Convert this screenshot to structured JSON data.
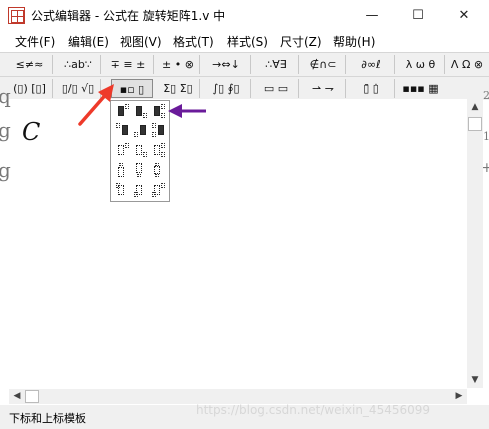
{
  "window": {
    "title": "公式编辑器 - 公式在 旋转矩阵1.v 中",
    "minimize_glyph": "—",
    "maximize_glyph": "☐",
    "close_glyph": "✕"
  },
  "menu": [
    "文件(F)",
    "编辑(E)",
    "视图(V)",
    "格式(T)",
    "样式(S)",
    "尺寸(Z)",
    "帮助(H)"
  ],
  "toolbar_row1": [
    "≤≠≈",
    "∴ab∵",
    "∓ ≡ ±",
    "± • ⊗",
    "→⇔↓",
    "∴∀∃",
    "∉∩⊂",
    "∂∞ℓ",
    "λ ω θ",
    "Λ Ω ⊗"
  ],
  "toolbar_row2": [
    "(▯) [▯]",
    "▯/▯ √▯",
    "▪▫ ▯",
    "Σ▯ Σ▯",
    "∫▯ ∮▯",
    "▭ ▭",
    "⇀ ⇁",
    "▯̄ ▯̇",
    "▪▪▪ ▦"
  ],
  "editor": {
    "math_char": "C",
    "faint_chars": [
      "q",
      "g",
      "g"
    ],
    "right_chars": [
      "2",
      "1",
      "+"
    ]
  },
  "popup_title": "下标和上标模板",
  "status": {
    "text": "下标和上标模板",
    "watermark": "https://blog.csdn.net/weixin_45456099"
  },
  "colors": {
    "red_arrow": "#ee3a2a",
    "purple_arrow": "#6a1b9a"
  }
}
